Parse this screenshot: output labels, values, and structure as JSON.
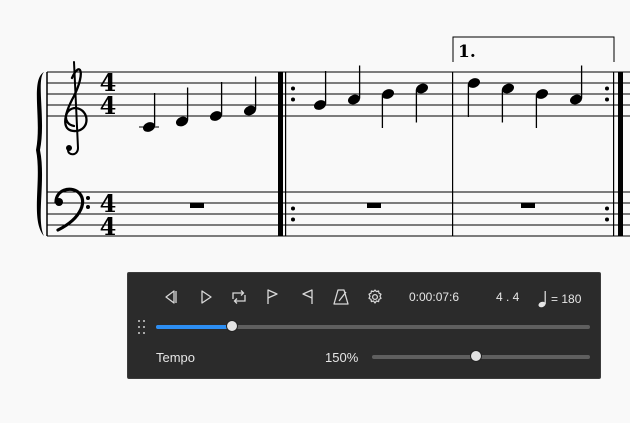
{
  "score": {
    "ending_label": "1.",
    "time_signature": {
      "numerator": "4",
      "denominator": "4"
    },
    "clefs": {
      "treble": "treble-clef",
      "bass": "bass-clef"
    },
    "treble_measures": [
      {
        "notes": [
          "C4",
          "D4",
          "E4",
          "F4"
        ]
      },
      {
        "notes": [
          "G4",
          "A4",
          "B4",
          "C5"
        ],
        "repeat": "start"
      },
      {
        "notes": [
          "D5",
          "C5",
          "B4",
          "A4"
        ],
        "repeat": "end",
        "ending": "1."
      }
    ],
    "bass_measures": [
      {
        "rest": "whole"
      },
      {
        "rest": "whole",
        "repeat": "start"
      },
      {
        "rest": "whole",
        "repeat": "end"
      }
    ]
  },
  "playback": {
    "icons": [
      "rewind-icon",
      "play-icon",
      "loop-icon",
      "loop-in-icon",
      "loop-out-icon",
      "metronome-icon",
      "settings-icon"
    ],
    "time": "0:00:07:6",
    "position": "4 . 4",
    "tempo_marking": "= 180",
    "progress": 0.176,
    "tempo_label": "Tempo",
    "tempo_percent": "150%",
    "tempo_slider": 0.478,
    "colors": {
      "panel": "#2b2b2b",
      "accent": "#2d8ef2",
      "icon": "#d8d8d8"
    }
  }
}
